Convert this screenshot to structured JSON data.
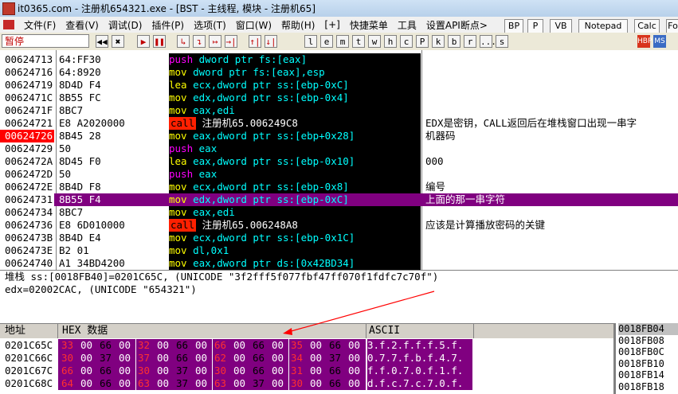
{
  "window": {
    "title": "it0365.com - 注册机654321.exe - [BST - 主线程, 模块 - 注册机65]"
  },
  "menu": [
    "文件(F)",
    "查看(V)",
    "调试(D)",
    "插件(P)",
    "选项(T)",
    "窗口(W)",
    "帮助(H)",
    "[+]",
    "快捷菜单",
    "工具",
    "设置API断点>"
  ],
  "plugin_buttons": [
    "BP",
    "P",
    "VB",
    "Notepad",
    "Calc",
    "Fo"
  ],
  "toolbar": {
    "status": "暂停",
    "buttons": [
      "◀◀",
      "✖",
      "▶",
      "❚❚",
      "↳",
      "↴",
      "↦",
      "→|",
      "↑|",
      "↓|",
      "l",
      "e",
      "m",
      "t",
      "w",
      "h",
      "c",
      "P",
      "k",
      "b",
      "r",
      "...",
      "s"
    ],
    "right_icons": [
      "HBP",
      "MS"
    ]
  },
  "disasm": {
    "rows": [
      {
        "addr": "00624713",
        "hex": "64:FF30",
        "op": "push",
        "operand": "dword ptr fs:[eax]",
        "comment": ""
      },
      {
        "addr": "00624716",
        "hex": "64:8920",
        "op": "mov",
        "operand": "dword ptr fs:[eax],esp",
        "comment": ""
      },
      {
        "addr": "00624719",
        "hex": "8D4D F4",
        "op": "lea",
        "operand": "ecx,dword ptr ss:[ebp-0xC]",
        "comment": ""
      },
      {
        "addr": "0062471C",
        "hex": "8B55 FC",
        "op": "mov",
        "operand": "edx,dword ptr ss:[ebp-0x4]",
        "comment": ""
      },
      {
        "addr": "0062471F",
        "hex": "8BC7",
        "op": "mov",
        "operand": "eax,edi",
        "comment": ""
      },
      {
        "addr": "00624721",
        "hex": "E8 A2020000",
        "op": "call",
        "operand": "注册机65.006249C8",
        "comment": "EDX是密钥，CALL返回后在堆栈窗口出现一串字"
      },
      {
        "addr": "00624726",
        "hex": "8B45 28",
        "op": "mov",
        "operand": "eax,dword ptr ss:[ebp+0x28]",
        "comment": "机器码"
      },
      {
        "addr": "00624729",
        "hex": "50",
        "op": "push",
        "operand": "eax",
        "comment": ""
      },
      {
        "addr": "0062472A",
        "hex": "8D45 F0",
        "op": "lea",
        "operand": "eax,dword ptr ss:[ebp-0x10]",
        "comment": "000"
      },
      {
        "addr": "0062472D",
        "hex": "50",
        "op": "push",
        "operand": "eax",
        "comment": ""
      },
      {
        "addr": "0062472E",
        "hex": "8B4D F8",
        "op": "mov",
        "operand": "ecx,dword ptr ss:[ebp-0x8]",
        "comment": "编号"
      },
      {
        "addr": "00624731",
        "hex": "8B55 F4",
        "op": "mov",
        "operand": "edx,dword ptr ss:[ebp-0xC]",
        "comment": "上面的那一串字符"
      },
      {
        "addr": "00624734",
        "hex": "8BC7",
        "op": "mov",
        "operand": "eax,edi",
        "comment": ""
      },
      {
        "addr": "00624736",
        "hex": "E8 6D010000",
        "op": "call",
        "operand": "注册机65.006248A8",
        "comment": "应该是计算播放密码的关键"
      },
      {
        "addr": "0062473B",
        "hex": "8B4D E4",
        "op": "mov",
        "operand": "ecx,dword ptr ss:[ebp-0x1C]",
        "comment": ""
      },
      {
        "addr": "0062473E",
        "hex": "B2 01",
        "op": "mov",
        "operand": "dl,0x1",
        "comment": ""
      },
      {
        "addr": "00624740",
        "hex": "A1 34BD4200",
        "op": "mov",
        "operand": "eax,dword ptr ds:[0x42BD34]",
        "comment": ""
      }
    ],
    "current_index": 6,
    "selected_index": 11
  },
  "info": {
    "line1": "堆栈 ss:[0018FB40]=0201C65C, (UNICODE \"3f2fff5f077fbf47ff070f1fdfc7c70f\")",
    "line2": "edx=02002CAC, (UNICODE \"654321\")"
  },
  "dump": {
    "headers": {
      "addr": "地址",
      "hex": "HEX 数据",
      "ascii": "ASCII"
    },
    "rows": [
      {
        "addr": "0201C65C",
        "bytes": [
          "33",
          "00",
          "66",
          "00",
          "32",
          "00",
          "66",
          "00",
          "66",
          "00",
          "66",
          "00",
          "35",
          "00",
          "66",
          "00"
        ],
        "ascii": "3.f.2.f.f.f.5.f."
      },
      {
        "addr": "0201C66C",
        "bytes": [
          "30",
          "00",
          "37",
          "00",
          "37",
          "00",
          "66",
          "00",
          "62",
          "00",
          "66",
          "00",
          "34",
          "00",
          "37",
          "00"
        ],
        "ascii": "0.7.7.f.b.f.4.7."
      },
      {
        "addr": "0201C67C",
        "bytes": [
          "66",
          "00",
          "66",
          "00",
          "30",
          "00",
          "37",
          "00",
          "30",
          "00",
          "66",
          "00",
          "31",
          "00",
          "66",
          "00"
        ],
        "ascii": "f.f.0.7.0.f.1.f."
      },
      {
        "addr": "0201C68C",
        "bytes": [
          "64",
          "00",
          "66",
          "00",
          "63",
          "00",
          "37",
          "00",
          "63",
          "00",
          "37",
          "00",
          "30",
          "00",
          "66",
          "00"
        ],
        "ascii": "d.f.c.7.c.7.0.f."
      }
    ]
  },
  "stack": {
    "rows": [
      "0018FB04",
      "0018FB08",
      "0018FB0C",
      "0018FB10",
      "0018FB14",
      "0018FB18"
    ],
    "selected_index": 0
  },
  "colors": {
    "asm_bg": "#000000",
    "selected_row": "#800080",
    "current_addr": "#ff0000",
    "arrow": "#ff0000"
  }
}
